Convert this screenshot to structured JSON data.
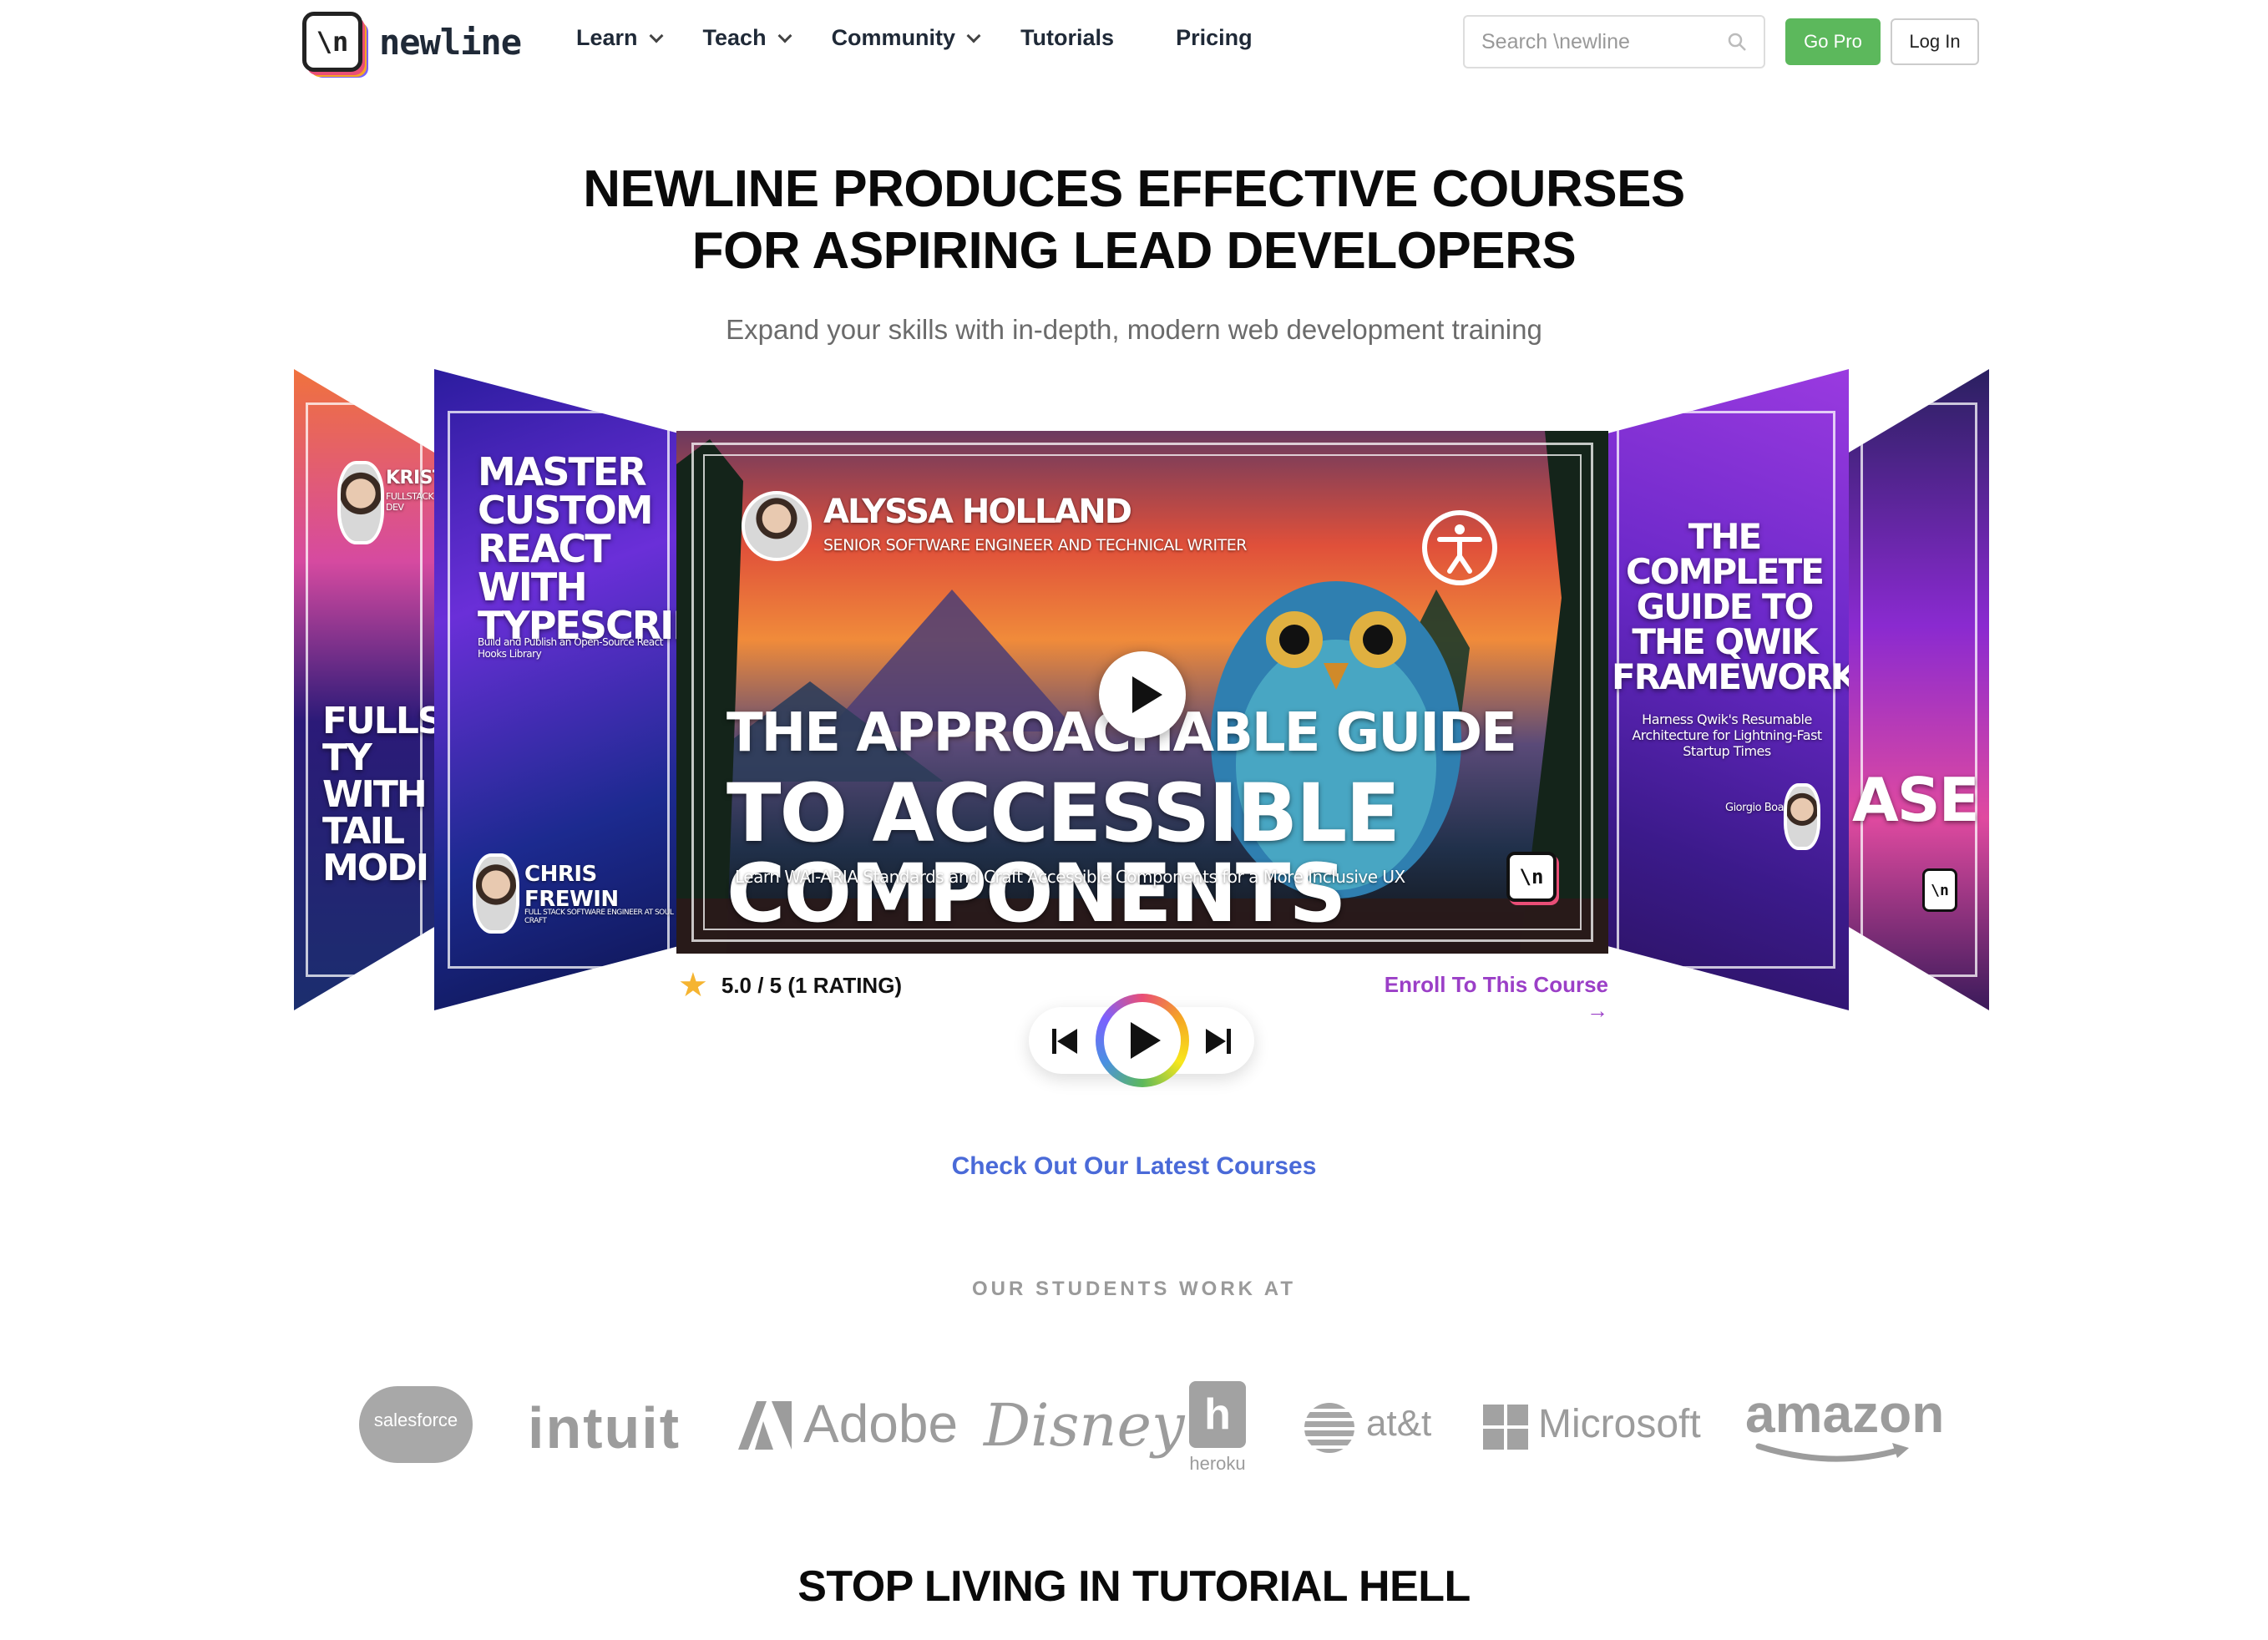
{
  "header": {
    "logo_glyph": "\\n",
    "logo_text": "newline",
    "menu": [
      {
        "label": "Learn",
        "has_dropdown": true
      },
      {
        "label": "Teach",
        "has_dropdown": true
      },
      {
        "label": "Community",
        "has_dropdown": true
      },
      {
        "label": "Tutorials",
        "has_dropdown": false
      },
      {
        "label": "Pricing",
        "has_dropdown": false
      }
    ],
    "search_placeholder": "Search \\newline",
    "go_pro_label": "Go Pro",
    "login_label": "Log In"
  },
  "hero": {
    "title_line1": "NEWLINE PRODUCES EFFECTIVE COURSES",
    "title_line2": "FOR ASPIRING LEAD DEVELOPERS",
    "subtitle": "Expand your skills with in-depth, modern web development training"
  },
  "carousel": {
    "cards": [
      {
        "title": "FULLSTACK TY WITH TAIL MODI",
        "author": "KRISTIA",
        "author_role": "FULLSTACK DEV"
      },
      {
        "title": "MASTER CUSTOM REACT WITH TYPESCRIPT",
        "subtitle": "Build and Publish an Open-Source React Hooks Library",
        "author": "CHRIS FREWIN",
        "author_role": "FULL STACK SOFTWARE ENGINEER AT SOUL CRAFT"
      },
      {
        "title_line1": "THE APPROACHABLE GUIDE",
        "title_line2": "TO ACCESSIBLE COMPONENTS",
        "subtitle": "Learn WAI-ARIA Standards and Craft Accessible Components for a More Inclusive UX",
        "author": "ALYSSA HOLLAND",
        "author_role": "SENIOR SOFTWARE ENGINEER AND TECHNICAL WRITER"
      },
      {
        "title": "THE COMPLETE GUIDE TO THE QWIK FRAMEWORK",
        "subtitle": "Harness Qwik's Resumable Architecture for Lightning-Fast Startup Times",
        "author": "Giorgio Boa"
      },
      {
        "title": "ASE"
      }
    ],
    "rating_text": "5.0 / 5 (1 RATING)",
    "enroll_label": "Enroll To This Course →",
    "latest_label": "Check Out Our Latest Courses"
  },
  "students": {
    "heading": "OUR STUDENTS WORK AT",
    "companies": [
      "salesforce",
      "intuit",
      "Adobe",
      "Disney",
      "heroku",
      "at&t",
      "Microsoft",
      "amazon"
    ]
  },
  "bottom": {
    "title": "STOP LIVING IN TUTORIAL HELL"
  },
  "colors": {
    "go_pro": "#5cb85c",
    "enroll": "#9b3fc7",
    "latest": "#4a6ad8",
    "logos_gray": "#9c9c9c"
  }
}
